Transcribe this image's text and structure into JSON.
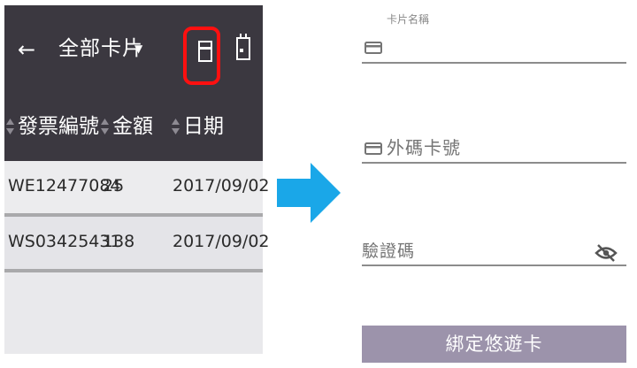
{
  "left_screen": {
    "app_bar": {
      "title": "全部卡片",
      "icons": [
        "back-arrow-icon",
        "dropdown-caret-icon",
        "card-icon",
        "calendar-icon"
      ],
      "highlight_color": "#ff1010",
      "background_color": "#3b3840"
    },
    "table": {
      "columns": [
        {
          "label": "發票編號",
          "sort_icon": "sort-icon"
        },
        {
          "label": "金額",
          "sort_icon": "sort-icon"
        },
        {
          "label": "日期",
          "sort_icon": "sort-icon"
        }
      ],
      "rows": [
        {
          "invoice": "WE12477084",
          "amount": "25",
          "date": "2017/09/02"
        },
        {
          "invoice": "WS03425431",
          "amount": "138",
          "date": "2017/09/02"
        }
      ]
    }
  },
  "transition_arrow": {
    "icon": "right-arrow-icon",
    "color": "#1aa7e8"
  },
  "right_screen": {
    "card_name_label": "卡片名稱",
    "card_name_value": "",
    "card_icon": "credit-card-icon",
    "external_number_placeholder": "外碼卡號",
    "verification_placeholder": "驗證碼",
    "visibility_icon": "visibility-off-icon",
    "bind_button_label": "綁定悠遊卡",
    "bind_button_color": "#9c93ab"
  }
}
